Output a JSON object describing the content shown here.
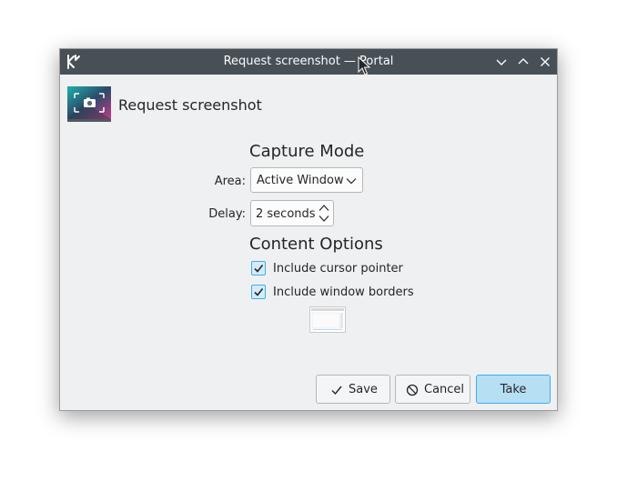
{
  "window": {
    "title": "Request screenshot — Portal"
  },
  "header": {
    "title": "Request screenshot"
  },
  "capture_mode": {
    "title": "Capture Mode",
    "area_label": "Area:",
    "area_value": "Active Window",
    "delay_label": "Delay:",
    "delay_value": "2 seconds"
  },
  "content_options": {
    "title": "Content Options",
    "include_cursor_label": "Include cursor pointer",
    "include_cursor_checked": true,
    "include_borders_label": "Include window borders",
    "include_borders_checked": true
  },
  "buttons": {
    "save_label": "Save",
    "cancel_label": "Cancel",
    "take_label": "Take"
  },
  "colors": {
    "titlebar": "#475057",
    "window_bg": "#eff0f1",
    "accent": "#3daee9",
    "default_button": "#b6dff3"
  },
  "icons": {
    "app": "kde-icon",
    "minimize": "chevron-down-icon",
    "maximize": "chevron-up-icon",
    "close": "close-icon",
    "header": "screenshot-app-icon",
    "save": "checkmark-icon",
    "cancel": "cancel-circle-icon"
  }
}
